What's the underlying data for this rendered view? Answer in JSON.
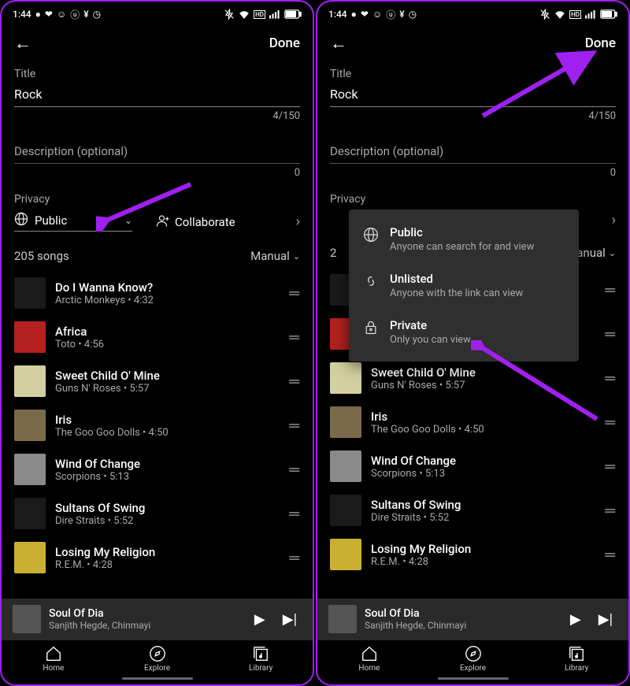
{
  "statusbar": {
    "time": "1:44"
  },
  "topbar": {
    "done": "Done"
  },
  "form": {
    "title_label": "Title",
    "title_value": "Rock",
    "title_counter": "4/150",
    "desc_placeholder": "Description (optional)",
    "desc_counter": "0",
    "privacy_label": "Privacy",
    "privacy_value": "Public",
    "collaborate": "Collaborate"
  },
  "sort": {
    "count": "205 songs",
    "mode": "Manual",
    "count_short": "2"
  },
  "songs": [
    {
      "title": "Do I Wanna Know?",
      "sub": "Arctic Monkeys • 4:32",
      "art": "#1a1a1a"
    },
    {
      "title": "Africa",
      "sub": "Toto • 4:56",
      "art": "#b52020"
    },
    {
      "title": "Sweet Child O' Mine",
      "sub": "Guns N' Roses • 5:57",
      "art": "#d4cfa0"
    },
    {
      "title": "Iris",
      "sub": "The Goo Goo Dolls • 4:50",
      "art": "#7a6a4a"
    },
    {
      "title": "Wind Of Change",
      "sub": "Scorpions • 5:13",
      "art": "#8a8a8a"
    },
    {
      "title": "Sultans Of Swing",
      "sub": "Dire Straits • 5:52",
      "art": "#1a1a1a"
    },
    {
      "title": "Losing My Religion",
      "sub": "R.E.M. • 4:28",
      "art": "#c9b030"
    }
  ],
  "nowplaying": {
    "title": "Soul Of Dia",
    "sub": "Sanjith Hegde, Chinmayi"
  },
  "nav": {
    "home": "Home",
    "explore": "Explore",
    "library": "Library"
  },
  "popup": {
    "public": {
      "title": "Public",
      "sub": "Anyone can search for and view"
    },
    "unlisted": {
      "title": "Unlisted",
      "sub": "Anyone with the link can view"
    },
    "private": {
      "title": "Private",
      "sub": "Only you can view"
    }
  }
}
